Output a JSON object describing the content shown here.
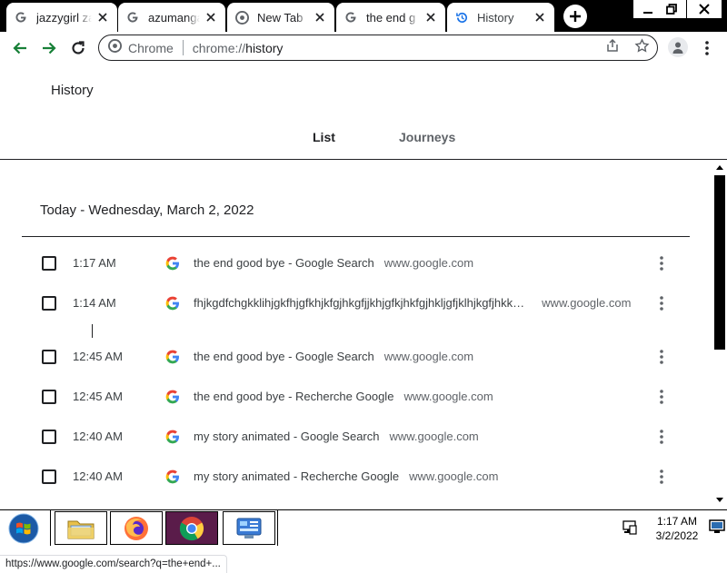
{
  "browser": {
    "tabs": [
      {
        "title": "jazzygirl za",
        "favicon": "google-g-icon"
      },
      {
        "title": "azumanga",
        "favicon": "google-g-icon"
      },
      {
        "title": "New Tab",
        "favicon": "chrome-icon"
      },
      {
        "title": "the end g",
        "favicon": "google-g-icon"
      },
      {
        "title": "History",
        "favicon": "history-icon",
        "active": true
      }
    ],
    "omnibox": {
      "site_label": "Chrome",
      "url_scheme": "chrome://",
      "url_path": "history"
    }
  },
  "history_page": {
    "title": "History",
    "tabs": [
      "List",
      "Journeys"
    ],
    "date_heading": "Today - Wednesday, March 2, 2022",
    "entries": [
      {
        "time": "1:17 AM",
        "title": "the end good bye - Google Search",
        "domain": "www.google.com"
      },
      {
        "time": "1:14 AM",
        "title": "fhjkgdfchgkklihjgkfhjgfkhjkfgjhkgfjjkhjgfkjhkfgjhkljgfjklhjkgfjhkk…",
        "domain": "www.google.com"
      },
      {
        "time": "12:45 AM",
        "title": "the end good bye - Google Search",
        "domain": "www.google.com"
      },
      {
        "time": "12:45 AM",
        "title": "the end good bye - Recherche Google",
        "domain": "www.google.com"
      },
      {
        "time": "12:40 AM",
        "title": "my story animated - Google Search",
        "domain": "www.google.com"
      },
      {
        "time": "12:40 AM",
        "title": "my story animated - Recherche Google",
        "domain": "www.google.com"
      }
    ]
  },
  "status_bar": {
    "url": "https://www.google.com/search?q=the+end+..."
  },
  "taskbar": {
    "time": "1:17 AM",
    "date": "3/2/2022"
  },
  "colors": {
    "accent_green": "#188038",
    "taskbar_active": "#5a1c4a"
  }
}
